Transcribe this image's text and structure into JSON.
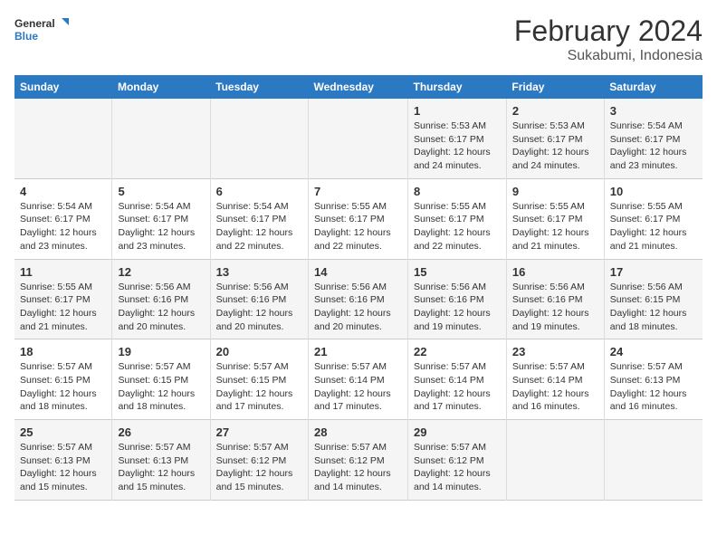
{
  "logo": {
    "line1": "General",
    "line2": "Blue"
  },
  "title": "February 2024",
  "location": "Sukabumi, Indonesia",
  "days_header": [
    "Sunday",
    "Monday",
    "Tuesday",
    "Wednesday",
    "Thursday",
    "Friday",
    "Saturday"
  ],
  "weeks": [
    [
      {
        "day": "",
        "info": ""
      },
      {
        "day": "",
        "info": ""
      },
      {
        "day": "",
        "info": ""
      },
      {
        "day": "",
        "info": ""
      },
      {
        "day": "1",
        "info": "Sunrise: 5:53 AM\nSunset: 6:17 PM\nDaylight: 12 hours\nand 24 minutes."
      },
      {
        "day": "2",
        "info": "Sunrise: 5:53 AM\nSunset: 6:17 PM\nDaylight: 12 hours\nand 24 minutes."
      },
      {
        "day": "3",
        "info": "Sunrise: 5:54 AM\nSunset: 6:17 PM\nDaylight: 12 hours\nand 23 minutes."
      }
    ],
    [
      {
        "day": "4",
        "info": "Sunrise: 5:54 AM\nSunset: 6:17 PM\nDaylight: 12 hours\nand 23 minutes."
      },
      {
        "day": "5",
        "info": "Sunrise: 5:54 AM\nSunset: 6:17 PM\nDaylight: 12 hours\nand 23 minutes."
      },
      {
        "day": "6",
        "info": "Sunrise: 5:54 AM\nSunset: 6:17 PM\nDaylight: 12 hours\nand 22 minutes."
      },
      {
        "day": "7",
        "info": "Sunrise: 5:55 AM\nSunset: 6:17 PM\nDaylight: 12 hours\nand 22 minutes."
      },
      {
        "day": "8",
        "info": "Sunrise: 5:55 AM\nSunset: 6:17 PM\nDaylight: 12 hours\nand 22 minutes."
      },
      {
        "day": "9",
        "info": "Sunrise: 5:55 AM\nSunset: 6:17 PM\nDaylight: 12 hours\nand 21 minutes."
      },
      {
        "day": "10",
        "info": "Sunrise: 5:55 AM\nSunset: 6:17 PM\nDaylight: 12 hours\nand 21 minutes."
      }
    ],
    [
      {
        "day": "11",
        "info": "Sunrise: 5:55 AM\nSunset: 6:17 PM\nDaylight: 12 hours\nand 21 minutes."
      },
      {
        "day": "12",
        "info": "Sunrise: 5:56 AM\nSunset: 6:16 PM\nDaylight: 12 hours\nand 20 minutes."
      },
      {
        "day": "13",
        "info": "Sunrise: 5:56 AM\nSunset: 6:16 PM\nDaylight: 12 hours\nand 20 minutes."
      },
      {
        "day": "14",
        "info": "Sunrise: 5:56 AM\nSunset: 6:16 PM\nDaylight: 12 hours\nand 20 minutes."
      },
      {
        "day": "15",
        "info": "Sunrise: 5:56 AM\nSunset: 6:16 PM\nDaylight: 12 hours\nand 19 minutes."
      },
      {
        "day": "16",
        "info": "Sunrise: 5:56 AM\nSunset: 6:16 PM\nDaylight: 12 hours\nand 19 minutes."
      },
      {
        "day": "17",
        "info": "Sunrise: 5:56 AM\nSunset: 6:15 PM\nDaylight: 12 hours\nand 18 minutes."
      }
    ],
    [
      {
        "day": "18",
        "info": "Sunrise: 5:57 AM\nSunset: 6:15 PM\nDaylight: 12 hours\nand 18 minutes."
      },
      {
        "day": "19",
        "info": "Sunrise: 5:57 AM\nSunset: 6:15 PM\nDaylight: 12 hours\nand 18 minutes."
      },
      {
        "day": "20",
        "info": "Sunrise: 5:57 AM\nSunset: 6:15 PM\nDaylight: 12 hours\nand 17 minutes."
      },
      {
        "day": "21",
        "info": "Sunrise: 5:57 AM\nSunset: 6:14 PM\nDaylight: 12 hours\nand 17 minutes."
      },
      {
        "day": "22",
        "info": "Sunrise: 5:57 AM\nSunset: 6:14 PM\nDaylight: 12 hours\nand 17 minutes."
      },
      {
        "day": "23",
        "info": "Sunrise: 5:57 AM\nSunset: 6:14 PM\nDaylight: 12 hours\nand 16 minutes."
      },
      {
        "day": "24",
        "info": "Sunrise: 5:57 AM\nSunset: 6:13 PM\nDaylight: 12 hours\nand 16 minutes."
      }
    ],
    [
      {
        "day": "25",
        "info": "Sunrise: 5:57 AM\nSunset: 6:13 PM\nDaylight: 12 hours\nand 15 minutes."
      },
      {
        "day": "26",
        "info": "Sunrise: 5:57 AM\nSunset: 6:13 PM\nDaylight: 12 hours\nand 15 minutes."
      },
      {
        "day": "27",
        "info": "Sunrise: 5:57 AM\nSunset: 6:12 PM\nDaylight: 12 hours\nand 15 minutes."
      },
      {
        "day": "28",
        "info": "Sunrise: 5:57 AM\nSunset: 6:12 PM\nDaylight: 12 hours\nand 14 minutes."
      },
      {
        "day": "29",
        "info": "Sunrise: 5:57 AM\nSunset: 6:12 PM\nDaylight: 12 hours\nand 14 minutes."
      },
      {
        "day": "",
        "info": ""
      },
      {
        "day": "",
        "info": ""
      }
    ]
  ]
}
